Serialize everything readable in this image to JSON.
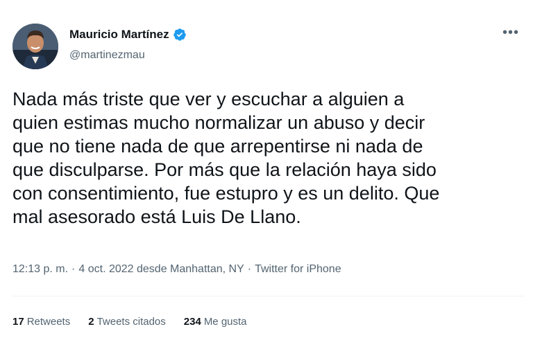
{
  "author": {
    "display_name": "Mauricio Martínez",
    "handle": "@martinezmau",
    "verified": true
  },
  "tweet": {
    "text": "Nada más triste que ver y escuchar a alguien a\nquien estimas mucho normalizar un abuso y decir\nque no tiene nada de que arrepentirse ni nada de\nque disculparse. Por más que la relación haya sido\ncon consentimiento, fue estupro y es un delito. Que\nmal asesorado está Luis De Llano.",
    "time": "12:13 p. m.",
    "sep1": "·",
    "date_location": "4 oct. 2022 desde Manhattan, NY",
    "sep2": "·",
    "source": "Twitter for iPhone"
  },
  "stats": {
    "retweets_count": "17",
    "retweets_label": "Retweets",
    "quotes_count": "2",
    "quotes_label": "Tweets citados",
    "likes_count": "234",
    "likes_label": "Me gusta"
  },
  "colors": {
    "verified_blue": "#1d9bf0",
    "text": "#0f1419",
    "secondary": "#536471"
  },
  "icons": {
    "more": "more-horizontal-icon",
    "verified": "verified-badge-icon"
  }
}
